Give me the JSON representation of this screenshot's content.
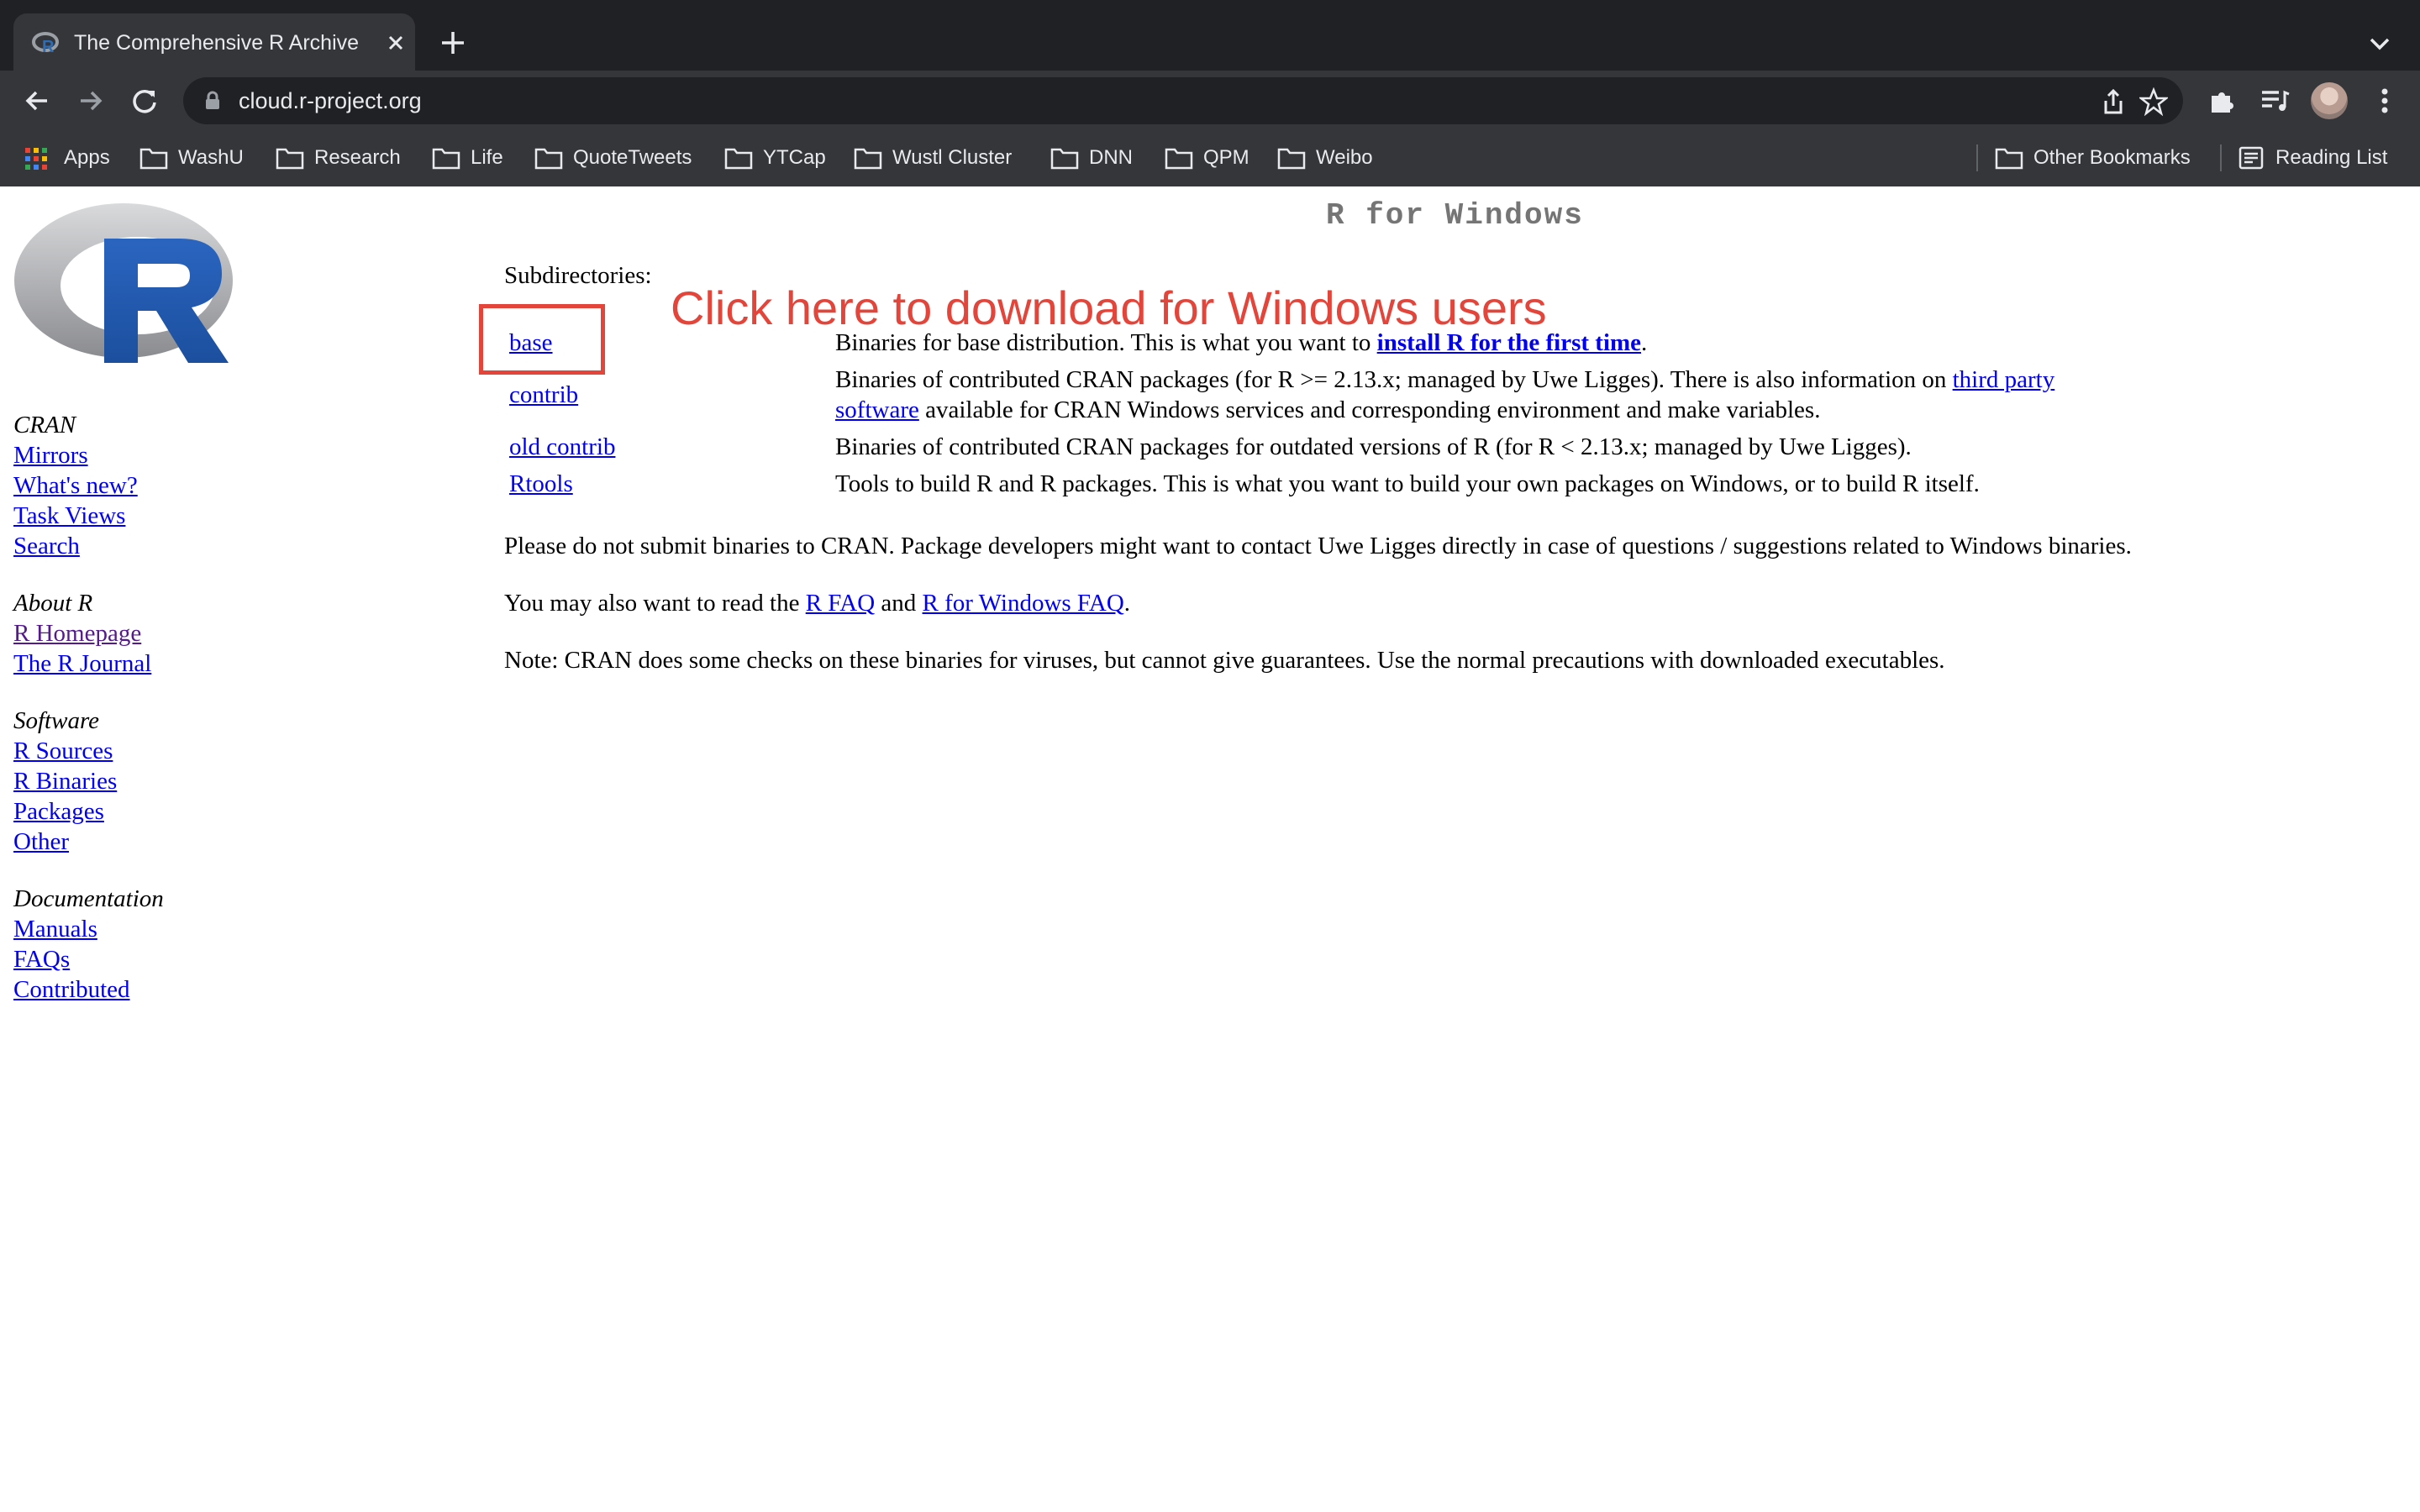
{
  "browser": {
    "tab_title": "The Comprehensive R Archive",
    "url": "cloud.r-project.org",
    "bookmarks": [
      {
        "label": "Apps",
        "icon": "apps-grid-icon"
      },
      {
        "label": "WashU",
        "icon": "folder-icon"
      },
      {
        "label": "Research",
        "icon": "folder-icon"
      },
      {
        "label": "Life",
        "icon": "folder-icon"
      },
      {
        "label": "QuoteTweets",
        "icon": "folder-icon"
      },
      {
        "label": "YTCap",
        "icon": "folder-icon"
      },
      {
        "label": "Wustl Cluster",
        "icon": "folder-icon"
      },
      {
        "label": "DNN",
        "icon": "folder-icon"
      },
      {
        "label": "QPM",
        "icon": "folder-icon"
      },
      {
        "label": "Weibo",
        "icon": "folder-icon"
      }
    ],
    "other_bookmarks": "Other Bookmarks",
    "reading_list": "Reading List"
  },
  "sidebar": {
    "groups": [
      {
        "heading": "CRAN",
        "links": [
          "Mirrors",
          "What's new?",
          "Task Views",
          "Search"
        ]
      },
      {
        "heading": "About R",
        "links": [
          "R Homepage",
          "The R Journal"
        ]
      },
      {
        "heading": "Software",
        "links": [
          "R Sources",
          "R Binaries",
          "Packages",
          "Other"
        ]
      },
      {
        "heading": "Documentation",
        "links": [
          "Manuals",
          "FAQs",
          "Contributed"
        ]
      }
    ]
  },
  "main": {
    "heading": "R for Windows",
    "subdirs_label": "Subdirectories:",
    "callout": "Click here to download for Windows users",
    "rows": [
      {
        "name": "base",
        "desc_before": "Binaries for base distribution. This is what you want to ",
        "desc_link": "install R for the first time",
        "desc_after": "."
      },
      {
        "name": "contrib",
        "desc_before": "Binaries of contributed CRAN packages (for R >= 2.13.x; managed by Uwe Ligges). There is also information on ",
        "desc_link": "third party",
        "desc_line2_link": "software",
        "desc_line2_after": " available for CRAN Windows services and corresponding environment and make variables."
      },
      {
        "name": "old contrib",
        "desc": "Binaries of contributed CRAN packages for outdated versions of R (for R < 2.13.x; managed by Uwe Ligges)."
      },
      {
        "name": "Rtools",
        "desc": "Tools to build R and R packages. This is what you want to build your own packages on Windows, or to build R itself."
      }
    ],
    "para1": "Please do not submit binaries to CRAN. Package developers might want to contact Uwe Ligges directly in case of questions / suggestions related to Windows binaries.",
    "para2_before": "You may also want to read the ",
    "para2_link1": "R FAQ",
    "para2_mid": " and ",
    "para2_link2": "R for Windows FAQ",
    "para2_after": ".",
    "para3": "Note: CRAN does some checks on these binaries for viruses, but cannot give guarantees. Use the normal precautions with downloaded executables."
  },
  "colors": {
    "callout": "#e3453b",
    "link": "#0000ee",
    "visited": "#551a8b"
  }
}
